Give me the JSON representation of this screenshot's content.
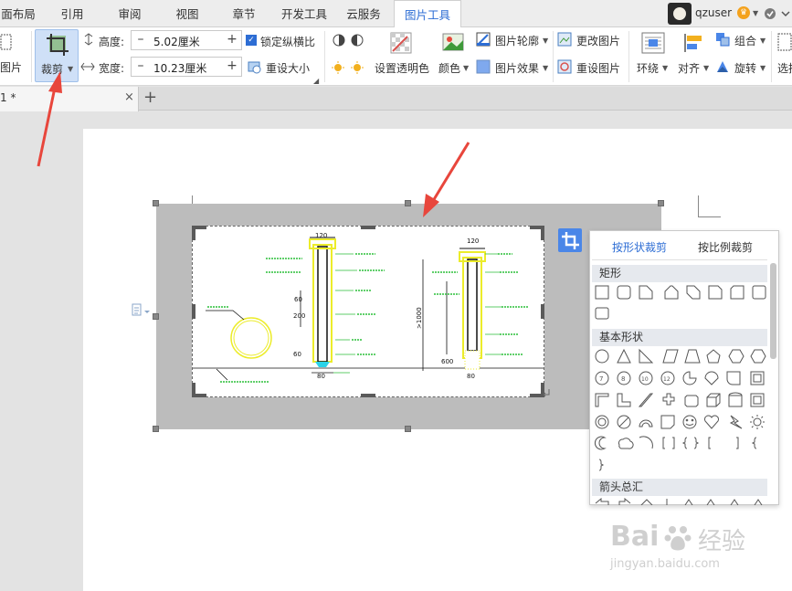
{
  "tabs": [
    "面布局",
    "引用",
    "审阅",
    "视图",
    "章节",
    "开发工具",
    "云服务",
    "图片工具"
  ],
  "active_tab": "图片工具",
  "user": {
    "name": "qzuser"
  },
  "ribbon": {
    "picture_label": "图片",
    "crop_label": "裁剪",
    "height_label": "高度:",
    "height_value": "5.02厘米",
    "width_label": "宽度:",
    "width_value": "10.23厘米",
    "lock_ratio_label": "锁定纵横比",
    "reset_size_label": "重设大小",
    "transparent_label": "设置透明色",
    "color_label": "颜色",
    "outline_label": "图片轮廓",
    "effect_label": "图片效果",
    "change_picture_label": "更改图片",
    "reset_picture_label": "重设图片",
    "wrap_label": "环绕",
    "align_label": "对齐",
    "group_label": "组合",
    "rotate_label": "旋转",
    "select_label": "选择"
  },
  "doc_tab": {
    "title": "1 *",
    "close": "×",
    "add": "+"
  },
  "crop_panel": {
    "tab_shape": "按形状裁剪",
    "tab_ratio": "按比例裁剪",
    "sections": [
      "矩形",
      "基本形状",
      "箭头总汇"
    ],
    "circle_numbers": [
      "7",
      "8",
      "10",
      "12"
    ]
  },
  "drawing_labels": {
    "left_top_dim": "120",
    "left_dim_a": "60",
    "left_dim_b": "200",
    "left_dim_c": "60",
    "left_dim_d": "80",
    "right_top_dim": "120",
    "right_dim_a": ">1000",
    "right_dim_b": "600",
    "right_dim_c": "80"
  },
  "watermark": {
    "brand": "Bai",
    "brand2": "经验",
    "url": "jingyan.baidu.com"
  },
  "colors": {
    "accent": "#2d6dd4",
    "arrow": "#e8463c",
    "crop_button": "#4a86e8",
    "drawing_yellow": "#ecec2a",
    "drawing_green": "#2bbf3a"
  }
}
